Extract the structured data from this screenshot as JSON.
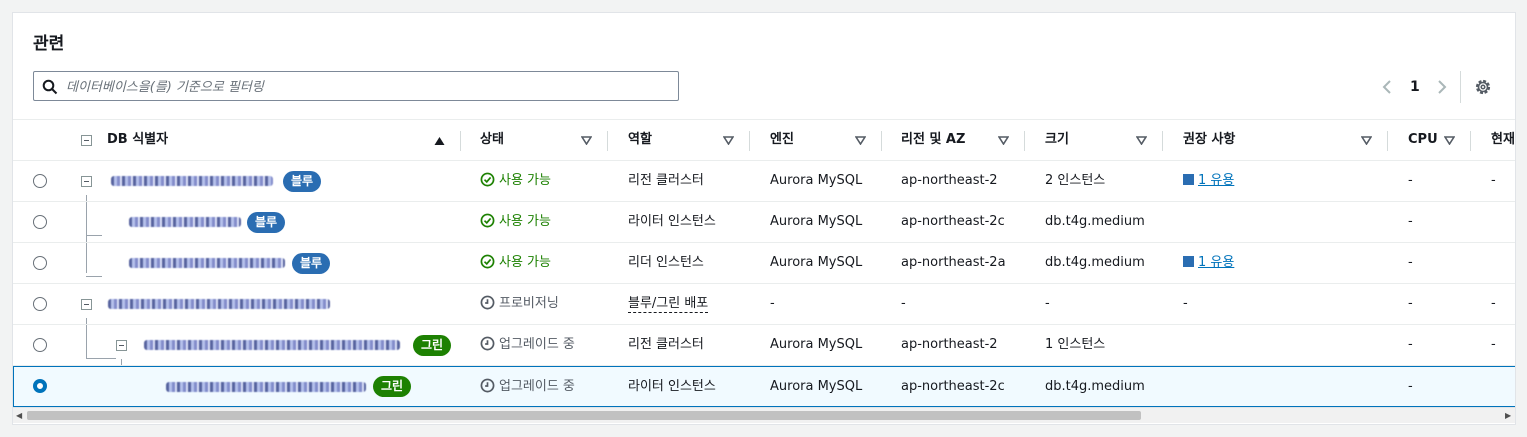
{
  "panel": {
    "title": "관련",
    "search": {
      "placeholder": "데이터베이스을(를) 기준으로 필터링"
    },
    "pagination": {
      "page": "1"
    }
  },
  "table": {
    "columns": [
      "DB 식별자",
      "상태",
      "역할",
      "엔진",
      "리전 및 AZ",
      "크기",
      "권장 사항",
      "CPU",
      "현재"
    ],
    "rows": [
      {
        "badge": "블루",
        "status": "사용 가능",
        "role": "리전 클러스터",
        "engine": "Aurora MySQL",
        "region": "ap-northeast-2",
        "size": "2 인스턴스",
        "recommendation": "1 유용",
        "cpu": "-",
        "current": "-"
      },
      {
        "badge": "블루",
        "status": "사용 가능",
        "role": "라이터 인스턴스",
        "engine": "Aurora MySQL",
        "region": "ap-northeast-2c",
        "size": "db.t4g.medium",
        "recommendation": "",
        "cpu": "-",
        "current": ""
      },
      {
        "badge": "블루",
        "status": "사용 가능",
        "role": "리더 인스턴스",
        "engine": "Aurora MySQL",
        "region": "ap-northeast-2a",
        "size": "db.t4g.medium",
        "recommendation": "1 유용",
        "cpu": "-",
        "current": ""
      },
      {
        "badge": "",
        "status": "프로비저닝",
        "role": "블루/그린 배포",
        "engine": "-",
        "region": "-",
        "size": "-",
        "recommendation": "-",
        "cpu": "-",
        "current": "-"
      },
      {
        "badge": "그린",
        "status": "업그레이드 중",
        "role": "리전 클러스터",
        "engine": "Aurora MySQL",
        "region": "ap-northeast-2",
        "size": "1 인스턴스",
        "recommendation": "",
        "cpu": "-",
        "current": "-"
      },
      {
        "badge": "그린",
        "status": "업그레이드 중",
        "role": "라이터 인스턴스",
        "engine": "Aurora MySQL",
        "region": "ap-northeast-2c",
        "size": "db.t4g.medium",
        "recommendation": "",
        "cpu": "-",
        "current": ""
      }
    ]
  },
  "icons": {
    "search": "search-icon",
    "settings": "gear-icon",
    "prev": "chevron-left-icon",
    "next": "chevron-right-icon"
  },
  "colors": {
    "accent": "#0073bb",
    "blue_badge": "#2a6db2",
    "green_badge": "#1d8102",
    "available": "#1d8102"
  }
}
